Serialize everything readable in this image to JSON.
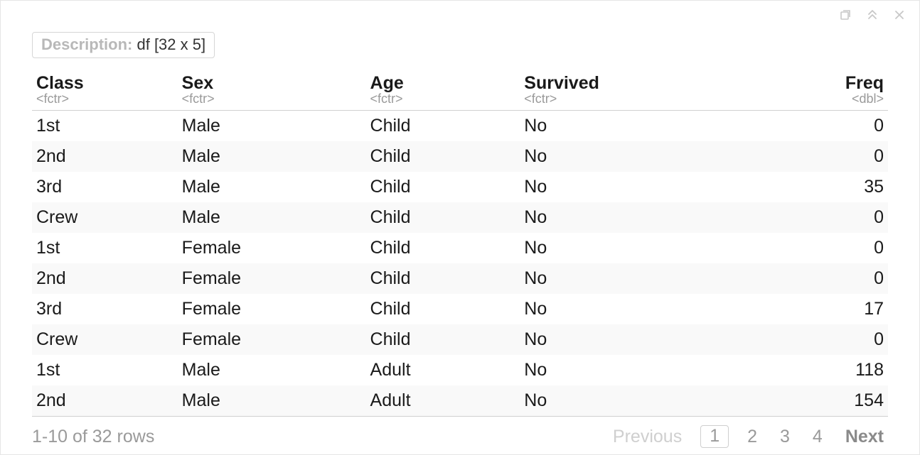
{
  "description": {
    "label": "Description:",
    "value": "df [32 x 5]"
  },
  "columns": [
    {
      "name": "Class",
      "type": "<fctr>",
      "align": "left"
    },
    {
      "name": "Sex",
      "type": "<fctr>",
      "align": "left"
    },
    {
      "name": "Age",
      "type": "<fctr>",
      "align": "left"
    },
    {
      "name": "Survived",
      "type": "<fctr>",
      "align": "left"
    },
    {
      "name": "Freq",
      "type": "<dbl>",
      "align": "right"
    }
  ],
  "rows": [
    {
      "Class": "1st",
      "Sex": "Male",
      "Age": "Child",
      "Survived": "No",
      "Freq": "0"
    },
    {
      "Class": "2nd",
      "Sex": "Male",
      "Age": "Child",
      "Survived": "No",
      "Freq": "0"
    },
    {
      "Class": "3rd",
      "Sex": "Male",
      "Age": "Child",
      "Survived": "No",
      "Freq": "35"
    },
    {
      "Class": "Crew",
      "Sex": "Male",
      "Age": "Child",
      "Survived": "No",
      "Freq": "0"
    },
    {
      "Class": "1st",
      "Sex": "Female",
      "Age": "Child",
      "Survived": "No",
      "Freq": "0"
    },
    {
      "Class": "2nd",
      "Sex": "Female",
      "Age": "Child",
      "Survived": "No",
      "Freq": "0"
    },
    {
      "Class": "3rd",
      "Sex": "Female",
      "Age": "Child",
      "Survived": "No",
      "Freq": "17"
    },
    {
      "Class": "Crew",
      "Sex": "Female",
      "Age": "Child",
      "Survived": "No",
      "Freq": "0"
    },
    {
      "Class": "1st",
      "Sex": "Male",
      "Age": "Adult",
      "Survived": "No",
      "Freq": "118"
    },
    {
      "Class": "2nd",
      "Sex": "Male",
      "Age": "Adult",
      "Survived": "No",
      "Freq": "154"
    }
  ],
  "footer": {
    "range": "1-10 of 32 rows",
    "pager": {
      "prev_label": "Previous",
      "next_label": "Next",
      "pages": [
        "1",
        "2",
        "3",
        "4"
      ],
      "current": "1",
      "prev_disabled": true,
      "next_disabled": false
    }
  },
  "controls": {
    "popout": "popout-icon",
    "collapse": "collapse-icon",
    "close": "close-icon"
  }
}
